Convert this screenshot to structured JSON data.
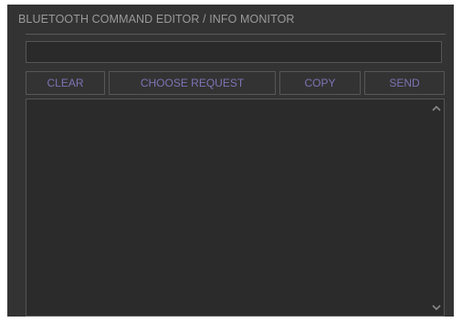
{
  "header": {
    "title": "BLUETOOTH COMMAND EDITOR / INFO MONITOR"
  },
  "command_input": {
    "value": "",
    "placeholder": ""
  },
  "toolbar": {
    "clear_label": "CLEAR",
    "choose_request_label": "CHOOSE REQUEST",
    "copy_label": "COPY",
    "send_label": "SEND"
  },
  "monitor": {
    "text": ""
  },
  "icons": {
    "scroll_up": "chevron-up-icon",
    "scroll_down": "chevron-down-icon"
  },
  "colors": {
    "panel_background": "#333333",
    "button_text": "#7d74b5",
    "title_text": "#9a9a9a"
  }
}
